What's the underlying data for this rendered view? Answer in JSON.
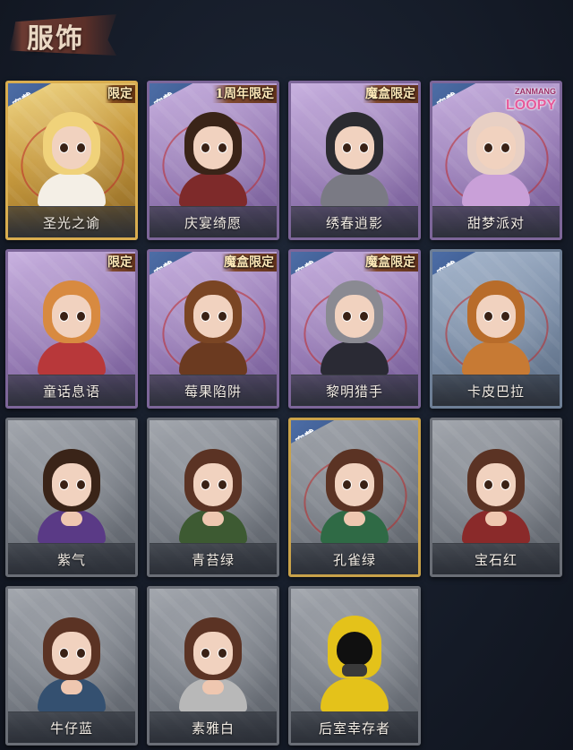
{
  "header": {
    "title": "服饰"
  },
  "labels": {
    "equipped": "穿戴"
  },
  "items": [
    {
      "name": "圣光之谕",
      "rarity": "gold",
      "tag": "限定",
      "equipped": true
    },
    {
      "name": "庆宴绮愿",
      "rarity": "purple",
      "tag": "1周年限定",
      "equipped": true
    },
    {
      "name": "绣春逍影",
      "rarity": "purple",
      "tag": "魔盒限定",
      "equipped": false
    },
    {
      "name": "甜梦派对",
      "rarity": "purple",
      "brand": "ZANMANG",
      "brand2": "LOOPY",
      "equipped": true
    },
    {
      "name": "童话息语",
      "rarity": "purple",
      "tag": "限定",
      "equipped": false
    },
    {
      "name": "莓果陷阱",
      "rarity": "purple",
      "tag": "魔盒限定",
      "equipped": true
    },
    {
      "name": "黎明猎手",
      "rarity": "purple",
      "tag": "魔盒限定",
      "equipped": true
    },
    {
      "name": "卡皮巴拉",
      "rarity": "blue",
      "equipped": true
    },
    {
      "name": "紫气",
      "rarity": "grey",
      "equipped": false
    },
    {
      "name": "青苔绿",
      "rarity": "grey",
      "equipped": false
    },
    {
      "name": "孔雀绿",
      "rarity": "grey",
      "equipped": true
    },
    {
      "name": "宝石红",
      "rarity": "grey",
      "equipped": false
    },
    {
      "name": "牛仔蓝",
      "rarity": "grey",
      "equipped": false
    },
    {
      "name": "素雅白",
      "rarity": "grey",
      "equipped": false
    },
    {
      "name": "后室幸存者",
      "rarity": "grey",
      "equipped": false
    }
  ],
  "colors": {
    "gold": "#d9ad4f",
    "purple": "#9a7fb8",
    "blue": "#7d8fa8",
    "grey": "#7b8088",
    "equipped_tag": "#3b5a8f"
  }
}
